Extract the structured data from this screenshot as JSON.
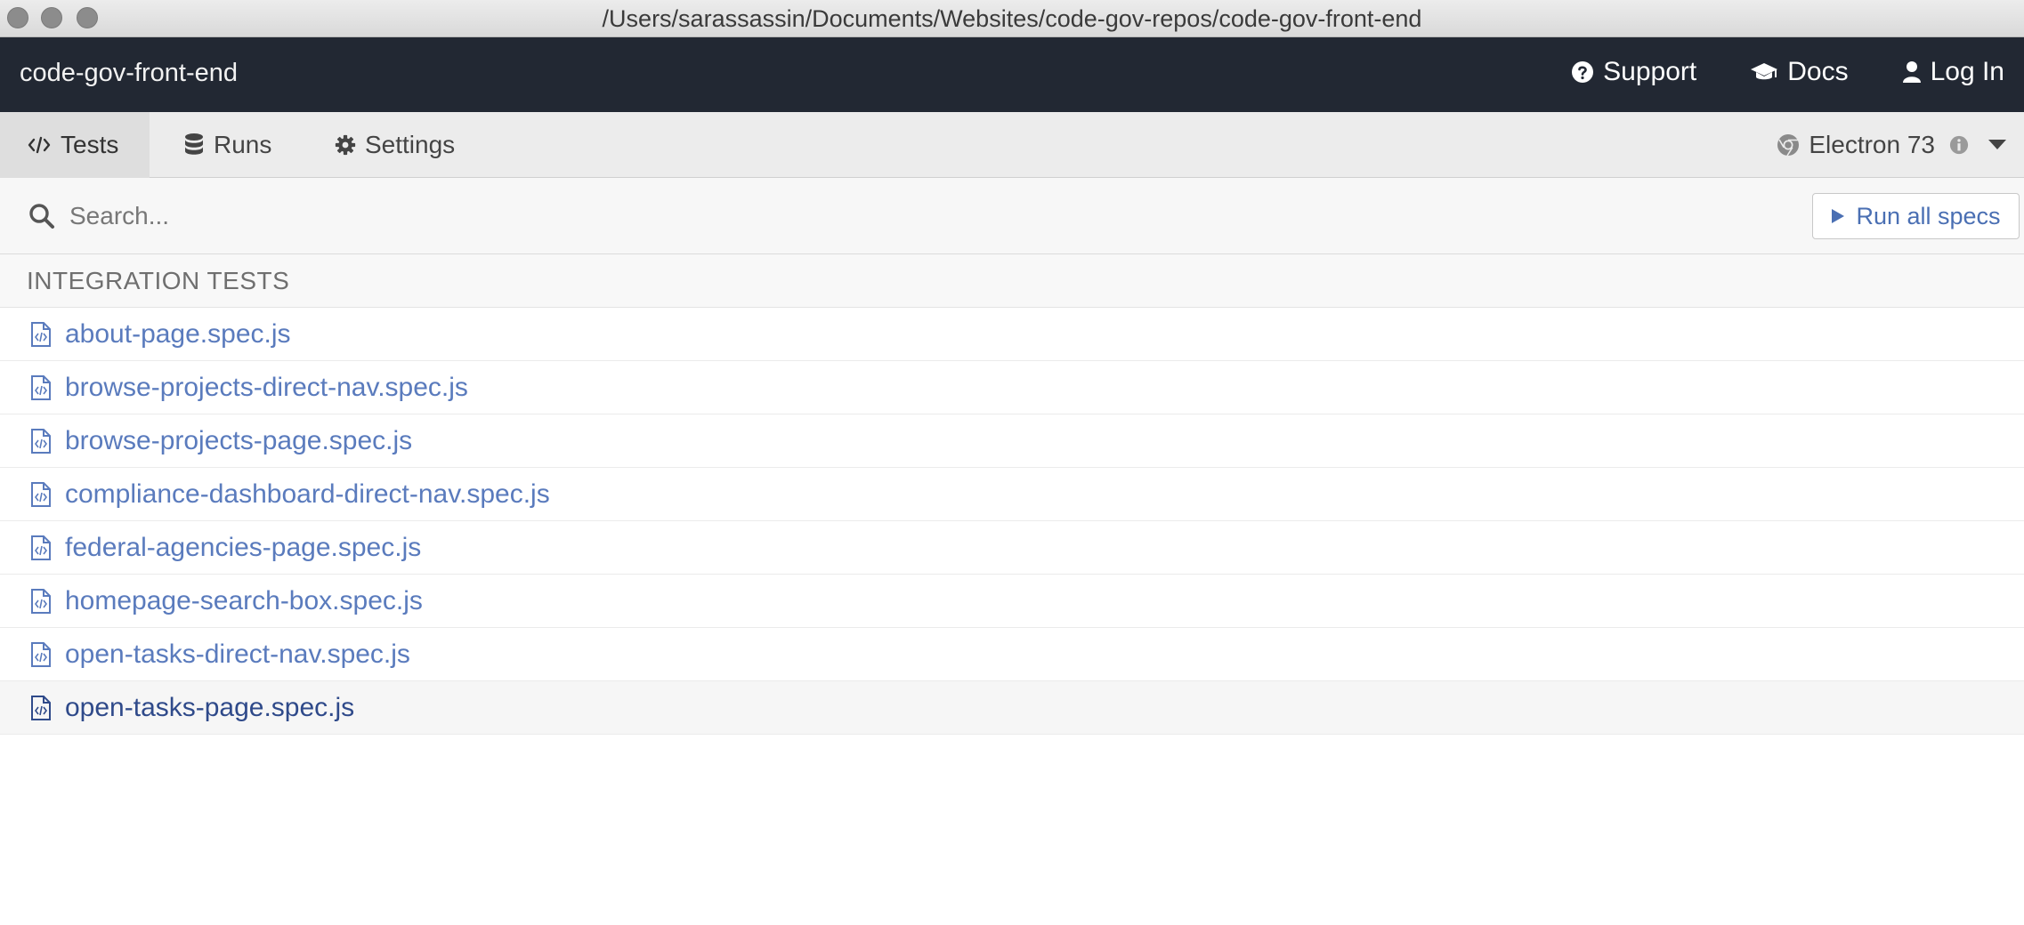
{
  "window": {
    "title": "/Users/sarassassin/Documents/Websites/code-gov-repos/code-gov-front-end"
  },
  "header": {
    "project_name": "code-gov-front-end",
    "support_label": "Support",
    "docs_label": "Docs",
    "login_label": "Log In"
  },
  "tabs": {
    "tests_label": "Tests",
    "runs_label": "Runs",
    "settings_label": "Settings",
    "browser_label": "Electron 73"
  },
  "search": {
    "placeholder": "Search...",
    "value": "",
    "run_all_label": "Run all specs"
  },
  "section": {
    "title": "INTEGRATION TESTS"
  },
  "specs": [
    "about-page.spec.js",
    "browse-projects-direct-nav.spec.js",
    "browse-projects-page.spec.js",
    "compliance-dashboard-direct-nav.spec.js",
    "federal-agencies-page.spec.js",
    "homepage-search-box.spec.js",
    "open-tasks-direct-nav.spec.js",
    "open-tasks-page.spec.js"
  ],
  "icons": {
    "support": "question-circle-icon",
    "docs": "graduation-cap-icon",
    "login": "user-icon",
    "tests": "code-icon",
    "runs": "database-icon",
    "settings": "gear-icon",
    "browser": "chrome-icon",
    "info": "info-circle-icon",
    "dropdown": "caret-down-icon",
    "search": "search-icon",
    "run": "play-icon",
    "spec": "file-code-icon"
  },
  "colors": {
    "header_bg": "#222833",
    "link": "#5a7bbd",
    "link_hover": "#2f4a8a"
  }
}
